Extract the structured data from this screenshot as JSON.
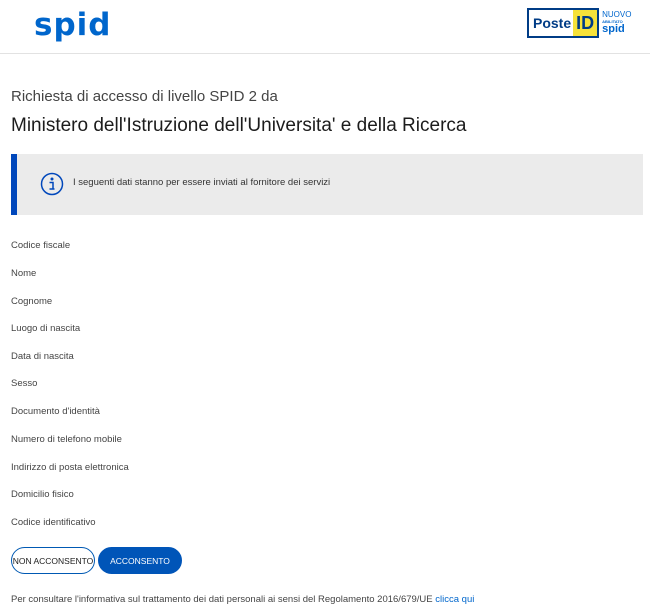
{
  "header": {
    "spid_logo_text": "spid",
    "poste_badge": {
      "poste": "Poste",
      "id": "ID",
      "nuovo": "NUOVO",
      "abilitato": "ABILITATO",
      "spid": "spid"
    }
  },
  "request": {
    "title": "Richiesta di accesso di livello SPID 2 da",
    "provider": "Ministero dell'Istruzione dell'Universita' e della Ricerca"
  },
  "info": {
    "icon": "info-icon",
    "text": "I seguenti dati stanno per essere inviati al fornitore dei servizi",
    "accent_color": "#0047bb"
  },
  "fields": [
    "Codice fiscale",
    "Nome",
    "Cognome",
    "Luogo di nascita",
    "Data di nascita",
    "Sesso",
    "Documento d'identità",
    "Numero di telefono mobile",
    "Indirizzo di posta elettronica",
    "Domicilio fisico",
    "Codice identificativo"
  ],
  "actions": {
    "deny_label": "NON ACCONSENTO",
    "accept_label": "ACCONSENTO"
  },
  "footer": {
    "text": "Per consultare l'informativa sul trattamento dei dati personali ai sensi del Regolamento 2016/679/UE",
    "link": "clicca qui"
  }
}
